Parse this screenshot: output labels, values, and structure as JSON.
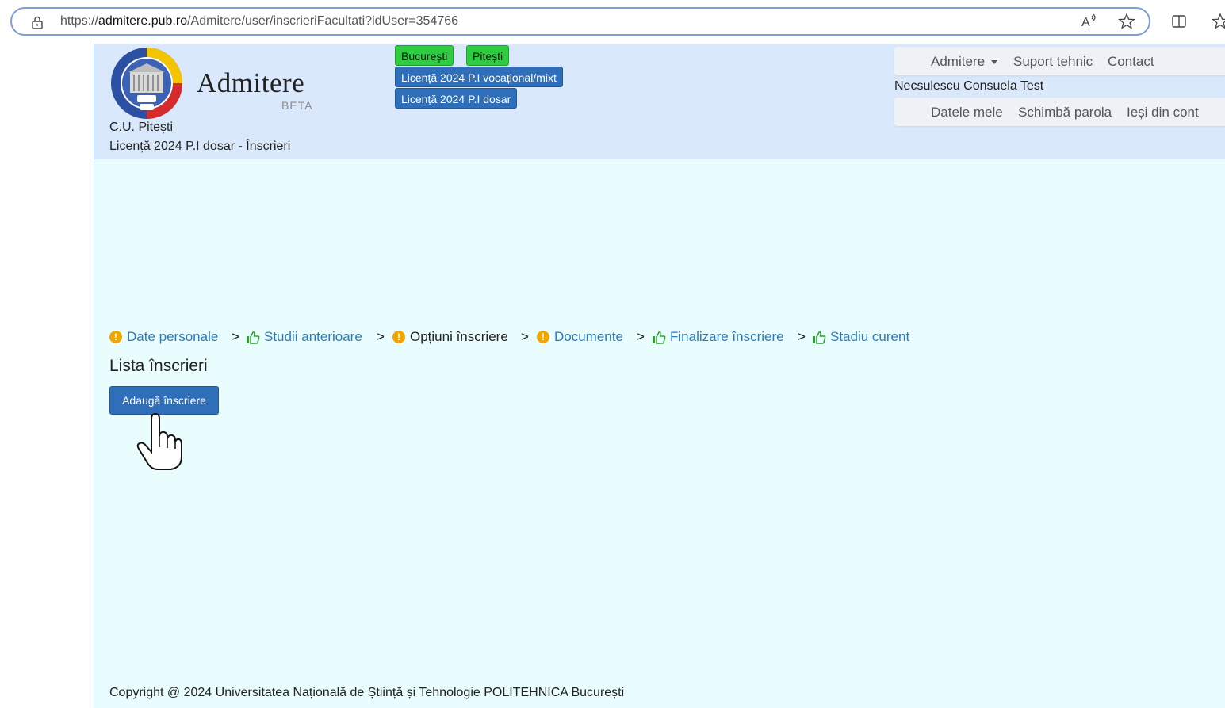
{
  "browser": {
    "url_prefix": "https://",
    "url_host": "admitere.pub.ro",
    "url_path": "/Admitere/user/inscrieriFacultati?idUser=354766",
    "icons": [
      "lock-icon",
      "read-aloud-icon",
      "favorite-star-icon",
      "split-screen-icon",
      "favorites-icon"
    ],
    "read_aloud_glyph": "A̩",
    "star_glyph": "☆"
  },
  "header": {
    "logo": "upb-seal-logo",
    "brand_title": "Admitere",
    "brand_sub": "BETA",
    "center_name": "C.U. Pitești",
    "subtitle": "Licență 2024 P.I dosar - Înscrieri",
    "city_buttons": [
      "București",
      "Pitești"
    ],
    "program_buttons": [
      "Licență 2024 P.I vocațional/mixt",
      "Licență 2024 P.I dosar"
    ],
    "top_menu": {
      "admitere": "Admitere",
      "support": "Suport tehnic",
      "contact": "Contact"
    },
    "user_name": "Necsulescu Consuela Test",
    "user_menu": {
      "my_data": "Datele mele",
      "change_password": "Schimbă parola",
      "logout": "Ieși din cont"
    }
  },
  "steps": {
    "separator": ">",
    "items": [
      {
        "label": "Date personale",
        "status": "warning"
      },
      {
        "label": "Studii anterioare",
        "status": "ok"
      },
      {
        "label": "Opțiuni înscriere",
        "status": "warning"
      },
      {
        "label": "Documente",
        "status": "warning"
      },
      {
        "label": "Finalizare înscriere",
        "status": "ok"
      },
      {
        "label": "Stadiu curent",
        "status": "ok"
      }
    ],
    "warning_glyph": "!"
  },
  "main": {
    "list_title": "Lista înscrieri",
    "add_button": "Adaugă înscriere"
  },
  "footer": {
    "copyright": "Copyright @ 2024 Universitatea Națională de Știință și Tehnologie POLITEHNICA București"
  },
  "colors": {
    "header_bg": "#d9e8fa",
    "page_bg": "#e9fdfe",
    "primary_blue": "#2f6fba",
    "green": "#2ecc40",
    "warning": "#f0a500",
    "ok_green": "#2aa02a",
    "link_blue": "#2a7ac0"
  }
}
